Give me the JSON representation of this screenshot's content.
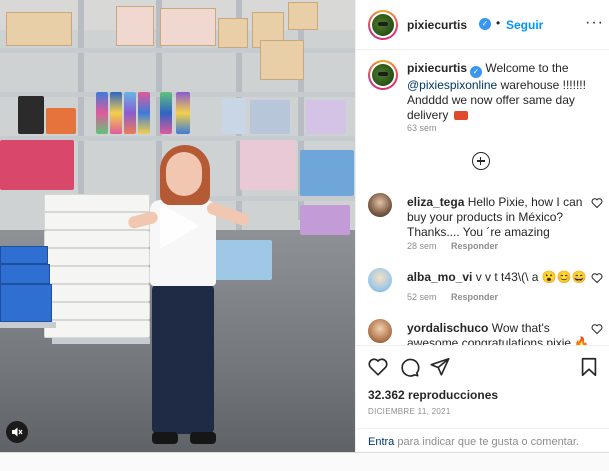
{
  "post": {
    "username": "pixiecurtis",
    "verified_mark": "✓",
    "separator": "•",
    "follow_label": "Seguir",
    "more_label": "···"
  },
  "caption": {
    "username": "pixiecurtis",
    "text_before": "Welcome to the",
    "mention": "@pixiespixonline",
    "text_after": "warehouse !!!!!!! Andddd we now offer same day delivery",
    "emoji_icon": "delivery-truck-icon",
    "time": "63 sem"
  },
  "comments": [
    {
      "username": "eliza_tega",
      "text": "Hello Pixie, how I can buy your products in México? Thanks.... You ´re amazing",
      "time": "28 sem",
      "reply_label": "Responder"
    },
    {
      "username": "alba_mo_vi",
      "text": "v v t t43\\(\\ a 😮😊😄",
      "time": "52 sem",
      "reply_label": "Responder"
    },
    {
      "username": "yordalischuco",
      "text": "Wow that's awesome congratulations pixie 🔥🔥🔥❤️❤️❤️",
      "time": "",
      "reply_label": ""
    }
  ],
  "actions": {
    "like_icon": "heart-icon",
    "comment_icon": "comment-icon",
    "share_icon": "share-icon",
    "save_icon": "bookmark-icon"
  },
  "stats": {
    "views": "32.362 reproducciones",
    "date": "DICIEMBRE 11, 2021"
  },
  "login_prompt": {
    "link": "Entra",
    "rest": "para indicar que te gusta o comentar."
  },
  "colors": {
    "accent": "#0095f6",
    "verified": "#3897f0",
    "muted": "#8e8e8e",
    "text": "#262626",
    "link": "#00376b"
  }
}
